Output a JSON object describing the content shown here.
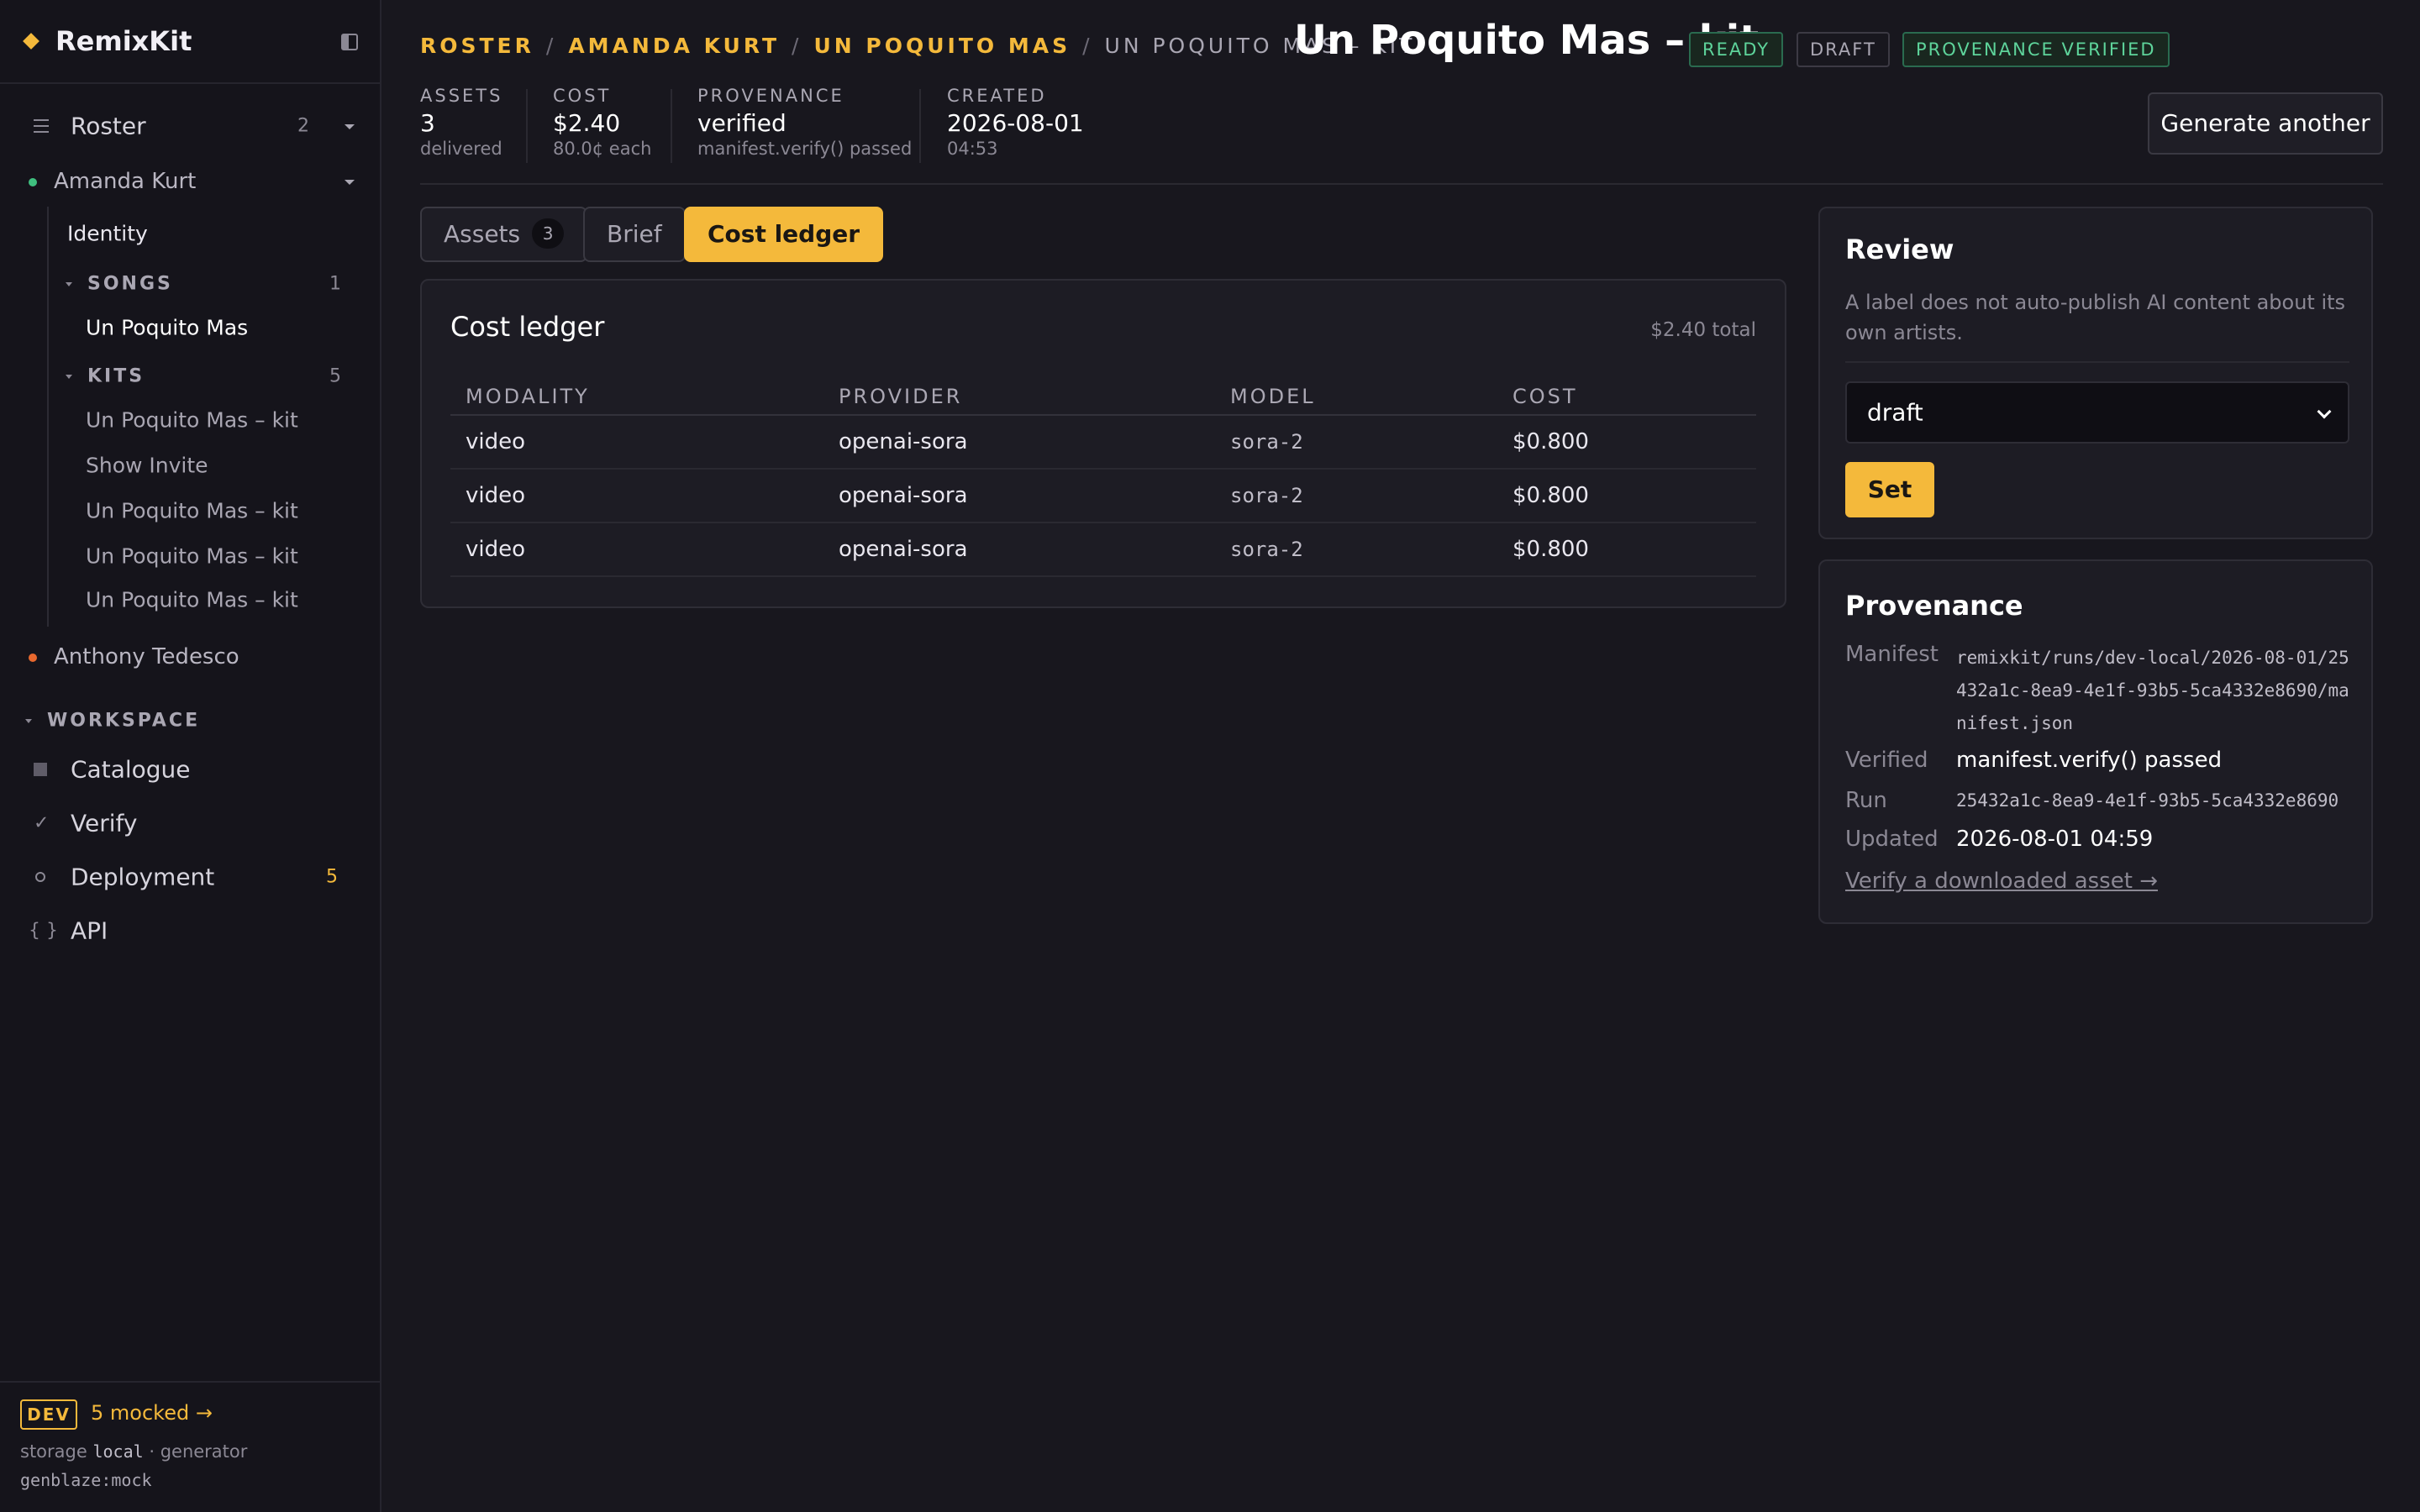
{
  "app": {
    "name": "RemixKit"
  },
  "sidebar": {
    "roster": {
      "label": "Roster",
      "count": "2"
    },
    "artists": [
      {
        "name": "Amanda Kurt",
        "status_color": "#3fbf7f"
      },
      {
        "name": "Anthony Tedesco",
        "status_color": "#e8682e"
      }
    ],
    "identity_label": "Identity",
    "songs": {
      "label": "SONGS",
      "count": "1",
      "items": [
        "Un Poquito Mas"
      ]
    },
    "kits": {
      "label": "KITS",
      "count": "5",
      "items": [
        "Un Poquito Mas – kit",
        "Show Invite",
        "Un Poquito Mas – kit",
        "Un Poquito Mas – kit",
        "Un Poquito Mas – kit"
      ]
    },
    "workspace": {
      "label": "WORKSPACE",
      "items": [
        {
          "label": "Catalogue",
          "icon": "square-icon"
        },
        {
          "label": "Verify",
          "icon": "check-icon"
        },
        {
          "label": "Deployment",
          "icon": "gear-icon",
          "count": "5"
        },
        {
          "label": "API",
          "icon": "braces-icon"
        }
      ]
    },
    "footer": {
      "dev_badge": "DEV",
      "mocked_link": "5 mocked →",
      "storage_prefix": "storage ",
      "storage_value": "local",
      "storage_suffix": " · generator",
      "generator_value": "genblaze:mock"
    }
  },
  "header": {
    "breadcrumbs": [
      "ROSTER",
      "AMANDA KURT",
      "UN POQUITO MAS"
    ],
    "breadcrumb_separator": "/",
    "breadcrumb_current": "UN POQUITO MAS – KIT",
    "title": "Un Poquito Mas – kit",
    "tags": [
      "READY",
      "DRAFT",
      "PROVENANCE VERIFIED"
    ],
    "stats": [
      {
        "label": "ASSETS",
        "value": "3",
        "sub": "delivered"
      },
      {
        "label": "COST",
        "value": "$2.40",
        "sub": "80.0¢ each"
      },
      {
        "label": "PROVENANCE",
        "value": "verified",
        "sub": "manifest.verify() passed"
      },
      {
        "label": "CREATED",
        "value": "2026-08-01",
        "sub": "04:53"
      }
    ],
    "generate_button": "Generate another"
  },
  "tabs": [
    {
      "label": "Assets",
      "count": "3"
    },
    {
      "label": "Brief"
    },
    {
      "label": "Cost ledger"
    }
  ],
  "ledger": {
    "title": "Cost ledger",
    "total": "$2.40 total",
    "columns": [
      "MODALITY",
      "PROVIDER",
      "MODEL",
      "COST"
    ],
    "rows": [
      [
        "video",
        "openai-sora",
        "sora-2",
        "$0.800"
      ],
      [
        "video",
        "openai-sora",
        "sora-2",
        "$0.800"
      ],
      [
        "video",
        "openai-sora",
        "sora-2",
        "$0.800"
      ]
    ]
  },
  "review": {
    "title": "Review",
    "description": "A label does not auto-publish AI content about its own artists.",
    "select_value": "draft",
    "set_button": "Set"
  },
  "provenance": {
    "title": "Provenance",
    "manifest_label": "Manifest",
    "manifest_value": "remixkit/runs/dev-local/2026-08-01/25432a1c-8ea9-4e1f-93b5-5ca4332e8690/manifest.json",
    "verified_label": "Verified",
    "verified_value": "manifest.verify() passed",
    "run_label": "Run",
    "run_value": "25432a1c-8ea9-4e1f-93b5-5ca4332e8690",
    "updated_label": "Updated",
    "updated_value": "2026-08-01 04:59",
    "verify_link": "Verify a downloaded asset →"
  },
  "colors": {
    "accent": "#f4b93b",
    "success": "#5ed49b",
    "background": "#18171e"
  }
}
